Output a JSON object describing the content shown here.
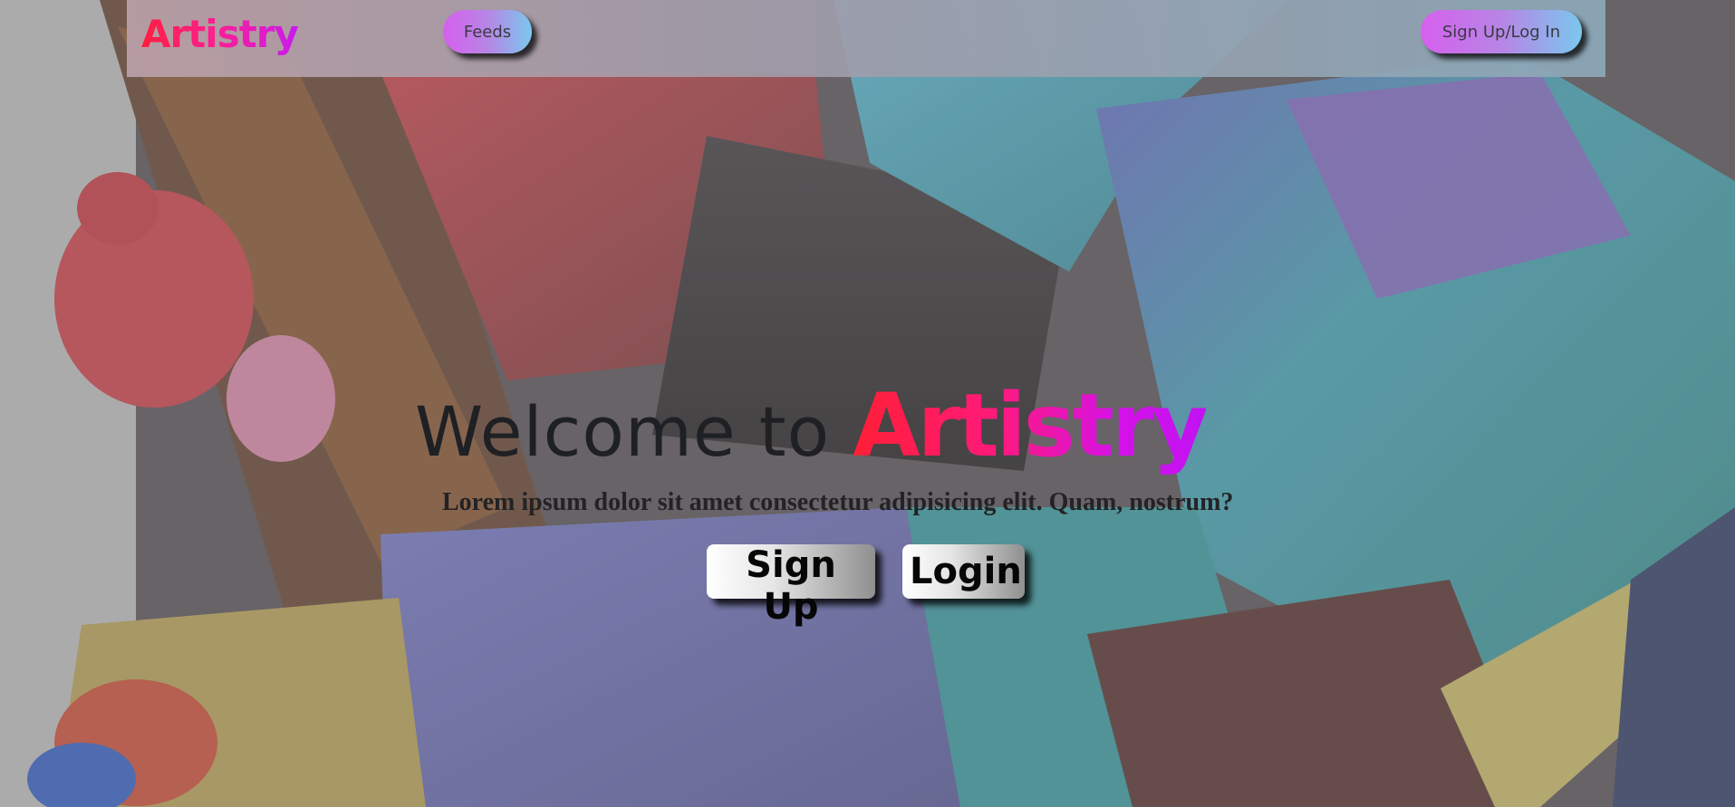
{
  "header": {
    "brand": "Artistry",
    "nav": {
      "feeds_label": "Feeds",
      "signup_login_label": "Sign Up/Log In"
    }
  },
  "hero": {
    "welcome_text": "Welcome to ",
    "brand_text": "Artistry",
    "subtitle": "Lorem ipsum dolor sit amet consectetur adipisicing elit. Quam, nostrum?",
    "signup_label": "Sign Up",
    "login_label": "Login"
  },
  "colors": {
    "brand_gradient_start": "#ff1f35",
    "brand_gradient_end": "#c112f2",
    "pill_gradient_start": "#d660ee",
    "pill_gradient_end": "#7bc7ee"
  },
  "background": {
    "description_icon": "paint-brushes-photo"
  }
}
